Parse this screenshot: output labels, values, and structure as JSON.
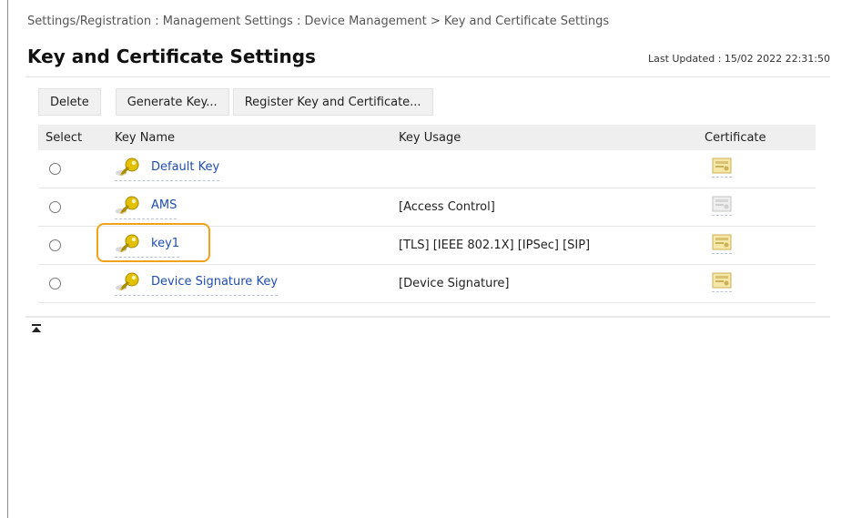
{
  "breadcrumb": "Settings/Registration : Management Settings : Device Management > Key and Certificate Settings",
  "title": "Key and Certificate Settings",
  "last_updated": "Last Updated : 15/02 2022 22:31:50",
  "toolbar": {
    "delete_label": "Delete",
    "generate_key_label": "Generate Key...",
    "register_label": "Register Key and Certificate..."
  },
  "table": {
    "headers": {
      "select": "Select",
      "key_name": "Key Name",
      "key_usage": "Key Usage",
      "certificate": "Certificate"
    },
    "rows": [
      {
        "name": "Default Key",
        "usage": "",
        "cert_icon": "certificate-icon-active"
      },
      {
        "name": "AMS",
        "usage": "[Access Control]",
        "cert_icon": "certificate-icon-disabled"
      },
      {
        "name": "key1",
        "usage": "[TLS] [IEEE 802.1X] [IPSec] [SIP]",
        "cert_icon": "certificate-icon-active"
      },
      {
        "name": "Device Signature Key",
        "usage": "[Device Signature]",
        "cert_icon": "certificate-icon-active"
      }
    ]
  },
  "icons": {
    "key": "key-icon",
    "scroll_top": "back-to-top-icon"
  },
  "colors": {
    "link": "#1f4db0",
    "highlight": "#f0a21b",
    "key_icon": "#d7b400"
  }
}
